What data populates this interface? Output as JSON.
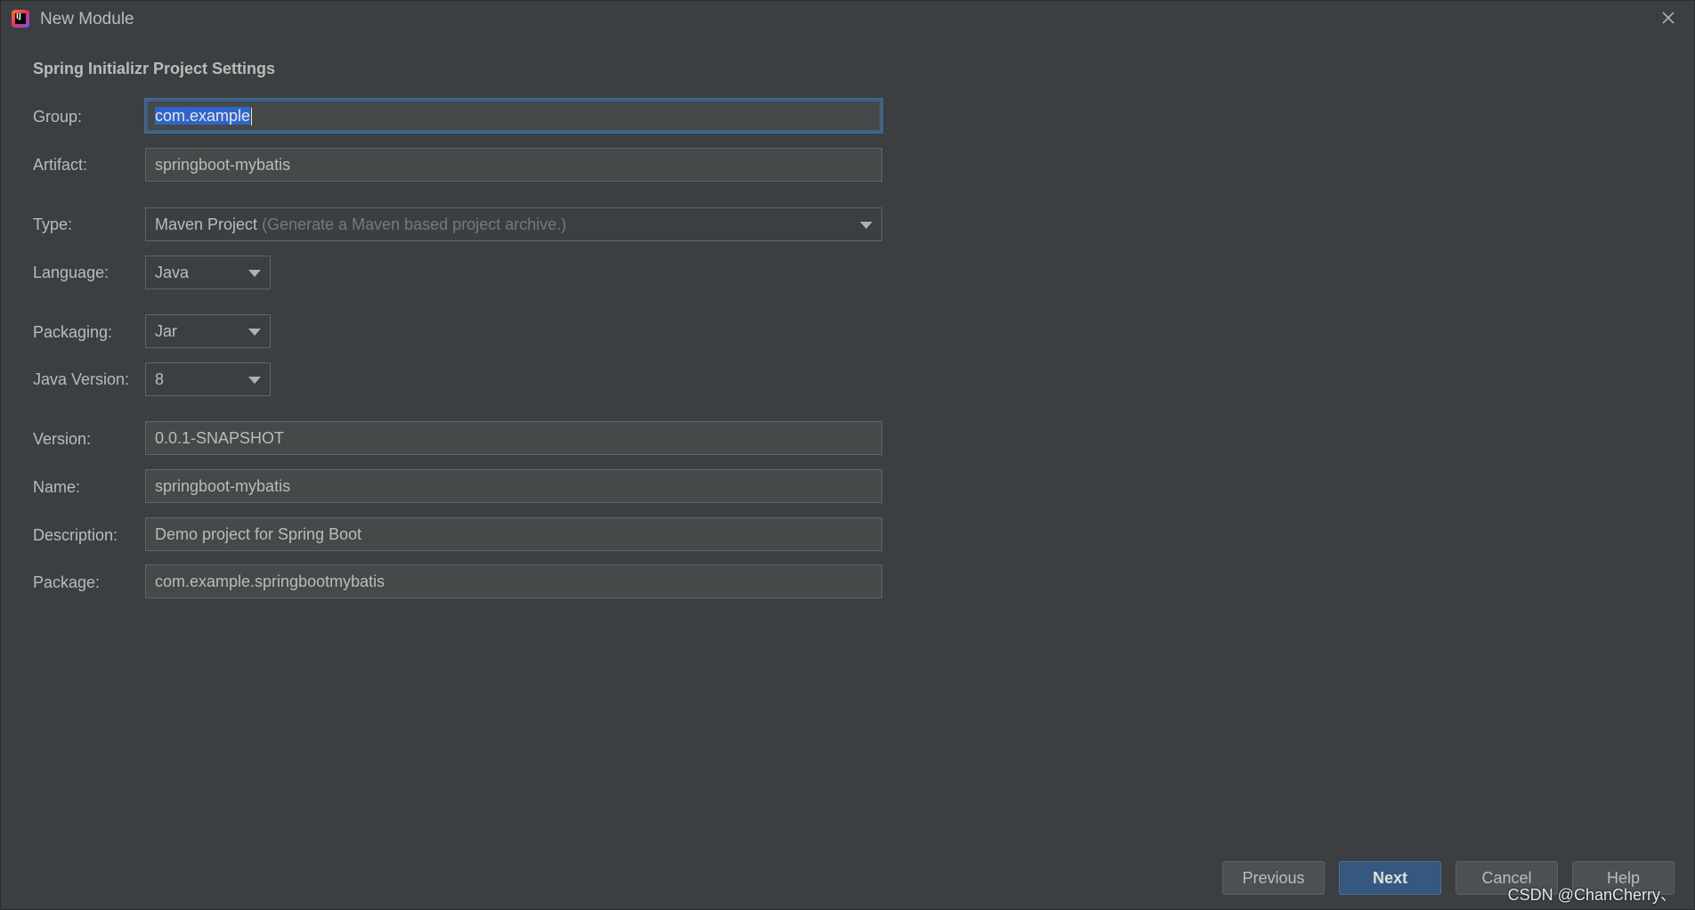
{
  "window": {
    "title": "New Module",
    "app_icon_text": "IJ"
  },
  "section_title": "Spring Initializr Project Settings",
  "fields": {
    "group": {
      "label": "Group:",
      "value": "com.example"
    },
    "artifact": {
      "label": "Artifact:",
      "value": "springboot-mybatis"
    },
    "type": {
      "label": "Type:",
      "value": "Maven Project",
      "hint": "(Generate a Maven based project archive.)"
    },
    "language": {
      "label": "Language:",
      "value": "Java"
    },
    "packaging": {
      "label": "Packaging:",
      "value": "Jar"
    },
    "java_version": {
      "label": "Java Version:",
      "value": "8"
    },
    "version": {
      "label": "Version:",
      "value": "0.0.1-SNAPSHOT"
    },
    "name": {
      "label": "Name:",
      "value": "springboot-mybatis"
    },
    "description": {
      "label": "Description:",
      "value": "Demo project for Spring Boot"
    },
    "package": {
      "label": "Package:",
      "value": "com.example.springbootmybatis"
    }
  },
  "buttons": {
    "previous": "Previous",
    "next": "Next",
    "cancel": "Cancel",
    "help": "Help"
  },
  "watermark": "CSDN @ChanCherry、",
  "colors": {
    "background": "#3c3f41",
    "field_background": "#45494a",
    "focus_border": "#3d6185",
    "selection": "#2f65ca",
    "primary_button": "#365880"
  }
}
